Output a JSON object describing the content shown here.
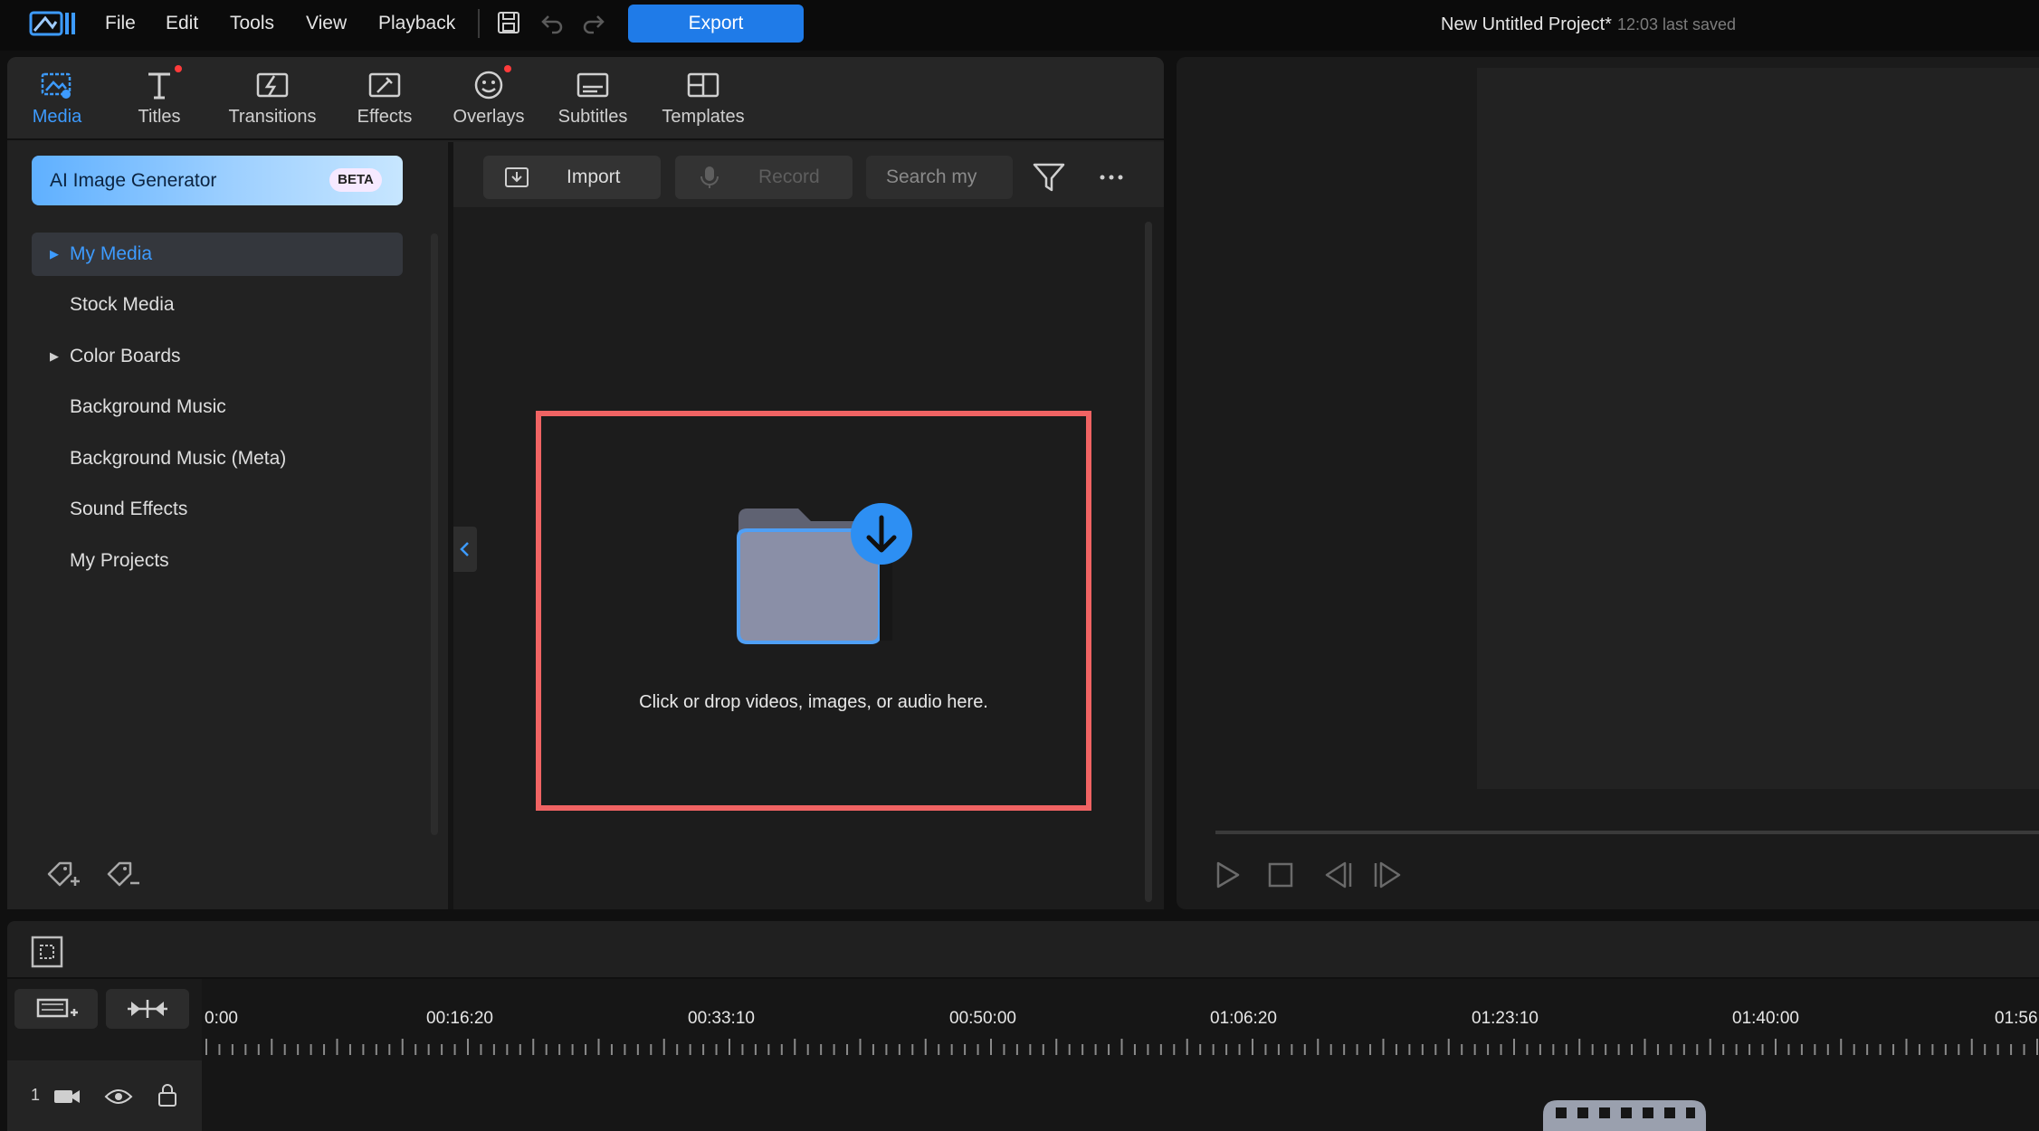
{
  "menu": {
    "items": [
      "File",
      "Edit",
      "Tools",
      "View",
      "Playback"
    ],
    "export_label": "Export"
  },
  "project": {
    "title": "New Untitled Project*",
    "saved": "12:03 last saved"
  },
  "library_tabs": [
    {
      "label": "Media",
      "icon": "media-icon",
      "active": true
    },
    {
      "label": "Titles",
      "icon": "titles-icon",
      "badge": true
    },
    {
      "label": "Transitions",
      "icon": "transitions-icon"
    },
    {
      "label": "Effects",
      "icon": "effects-icon"
    },
    {
      "label": "Overlays",
      "icon": "overlays-icon",
      "badge": true
    },
    {
      "label": "Subtitles",
      "icon": "subtitles-icon"
    },
    {
      "label": "Templates",
      "icon": "templates-icon"
    }
  ],
  "sidebar": {
    "ai_generator": "AI Image Generator",
    "beta": "BETA",
    "items": [
      {
        "label": "My Media",
        "expandable": true,
        "selected": true
      },
      {
        "label": "Stock Media"
      },
      {
        "label": "Color Boards",
        "expandable": true
      },
      {
        "label": "Background Music"
      },
      {
        "label": "Background Music (Meta)"
      },
      {
        "label": "Sound Effects"
      },
      {
        "label": "My Projects"
      }
    ]
  },
  "media_toolbar": {
    "import_label": "Import",
    "record_label": "Record",
    "search_placeholder": "Search my"
  },
  "drop_zone": {
    "text": "Click or drop videos, images, or audio here."
  },
  "timeline": {
    "ruler": [
      "0:00",
      "00:16:20",
      "00:33:10",
      "00:50:00",
      "01:06:20",
      "01:23:10",
      "01:40:00",
      "01:56"
    ],
    "track_number": "1"
  },
  "colors": {
    "accent": "#1f7be8",
    "active_tab": "#3d9bff",
    "highlight_border": "#f06363"
  }
}
